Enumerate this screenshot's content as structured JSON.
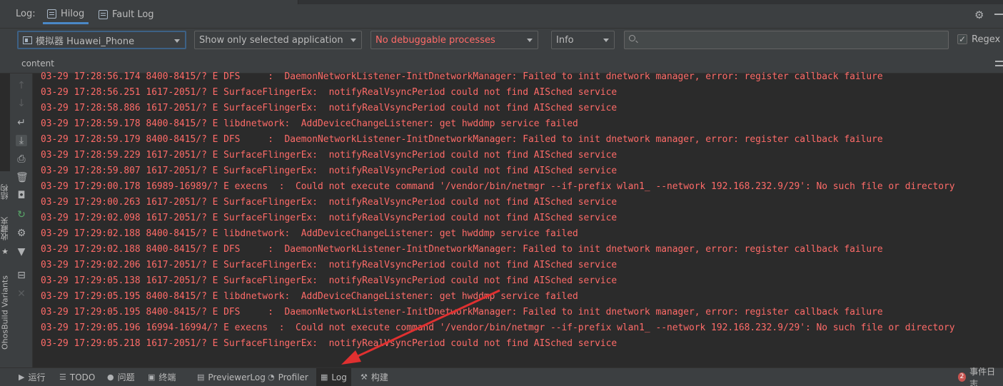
{
  "header": {
    "log_label": "Log:",
    "tabs": [
      {
        "label": "Hilog",
        "active": true
      },
      {
        "label": "Fault Log",
        "active": false
      }
    ]
  },
  "filters": {
    "device": "模拟器 Huawei_Phone",
    "app_filter": "Show only selected application",
    "process": "No debuggable processes",
    "level": "Info",
    "search_value": "",
    "regex_label": "Regex",
    "regex_checked": true,
    "checkmark": "✓"
  },
  "content_label": "content",
  "side_labels": {
    "structure": "结构",
    "favorites": "收藏夹",
    "build_variants": "OhosBuild Variants"
  },
  "log_lines": [
    "03-29 17:28:56.174 8400-8415/? E DFS     :  DaemonNetworkListener-InitDnetworkManager: Failed to init dnetwork manager, error: register callback failure",
    "03-29 17:28:56.251 1617-2051/? E SurfaceFlingerEx:  notifyRealVsyncPeriod could not find AISched service",
    "03-29 17:28:58.886 1617-2051/? E SurfaceFlingerEx:  notifyRealVsyncPeriod could not find AISched service",
    "03-29 17:28:59.178 8400-8415/? E libdnetwork:  AddDeviceChangeListener: get hwddmp service failed",
    "03-29 17:28:59.179 8400-8415/? E DFS     :  DaemonNetworkListener-InitDnetworkManager: Failed to init dnetwork manager, error: register callback failure",
    "03-29 17:28:59.229 1617-2051/? E SurfaceFlingerEx:  notifyRealVsyncPeriod could not find AISched service",
    "03-29 17:28:59.807 1617-2051/? E SurfaceFlingerEx:  notifyRealVsyncPeriod could not find AISched service",
    "03-29 17:29:00.178 16989-16989/? E execns  :  Could not execute command '/vendor/bin/netmgr --if-prefix wlan1_ --network 192.168.232.9/29': No such file or directory",
    "03-29 17:29:00.263 1617-2051/? E SurfaceFlingerEx:  notifyRealVsyncPeriod could not find AISched service",
    "03-29 17:29:02.098 1617-2051/? E SurfaceFlingerEx:  notifyRealVsyncPeriod could not find AISched service",
    "03-29 17:29:02.188 8400-8415/? E libdnetwork:  AddDeviceChangeListener: get hwddmp service failed",
    "03-29 17:29:02.188 8400-8415/? E DFS     :  DaemonNetworkListener-InitDnetworkManager: Failed to init dnetwork manager, error: register callback failure",
    "03-29 17:29:02.206 1617-2051/? E SurfaceFlingerEx:  notifyRealVsyncPeriod could not find AISched service",
    "03-29 17:29:05.138 1617-2051/? E SurfaceFlingerEx:  notifyRealVsyncPeriod could not find AISched service",
    "03-29 17:29:05.195 8400-8415/? E libdnetwork:  AddDeviceChangeListener: get hwddmp service failed",
    "03-29 17:29:05.195 8400-8415/? E DFS     :  DaemonNetworkListener-InitDnetworkManager: Failed to init dnetwork manager, error: register callback failure",
    "03-29 17:29:05.196 16994-16994/? E execns  :  Could not execute command '/vendor/bin/netmgr --if-prefix wlan1_ --network 192.168.232.9/29': No such file or directory",
    "03-29 17:29:05.218 1617-2051/? E SurfaceFlingerEx:  notifyRealVsyncPeriod could not find AISched service"
  ],
  "bottom_tabs": [
    {
      "label": "运行",
      "icon": "play-icon",
      "glyph": "▶",
      "active": false
    },
    {
      "label": "TODO",
      "icon": "list-icon",
      "glyph": "☰",
      "active": false
    },
    {
      "label": "问题",
      "icon": "problems-icon",
      "glyph": "●",
      "active": false
    },
    {
      "label": "终端",
      "icon": "terminal-icon",
      "glyph": "▣",
      "active": false
    },
    {
      "label": "PreviewerLog",
      "icon": "previewer-log-icon",
      "glyph": "▤",
      "active": false
    },
    {
      "label": "Profiler",
      "icon": "profiler-icon",
      "glyph": "◔",
      "active": false
    },
    {
      "label": "Log",
      "icon": "log-icon",
      "glyph": "▦",
      "active": true
    },
    {
      "label": "构建",
      "icon": "hammer-icon",
      "glyph": "⚒",
      "active": false
    }
  ],
  "event_log": {
    "badge": "2",
    "label": "事件日志"
  },
  "colors": {
    "error_text": "#ff6b68",
    "background": "#2b2b2b",
    "panel": "#3c3f41",
    "accent": "#4a88c7",
    "annotation_arrow": "#e03030"
  }
}
